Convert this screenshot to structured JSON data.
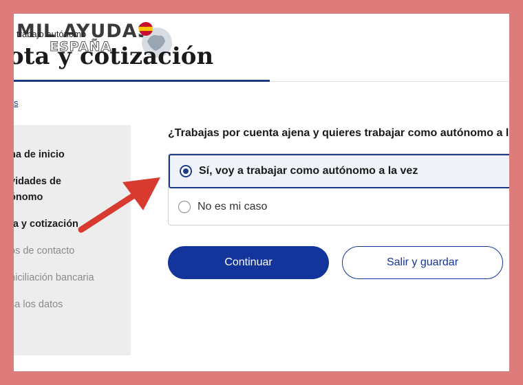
{
  "breadcrumb": "trabajo autónomo",
  "logo": {
    "line1": "MIL AYUDAS",
    "line2": "ESPAÑA"
  },
  "page_title": "ota y cotización",
  "back_link": "s",
  "sidebar": {
    "items": [
      {
        "label": "na de inicio",
        "state": "done"
      },
      {
        "label_line1": "vidades de",
        "label_line2": "ónomo",
        "state": "done"
      },
      {
        "label": "ta y cotización",
        "state": "current"
      },
      {
        "label": "os de contacto",
        "state": "todo"
      },
      {
        "label": "niciliación bancaria",
        "state": "todo"
      },
      {
        "label": "sa los datos",
        "state": "todo"
      }
    ]
  },
  "question": "¿Trabajas por cuenta ajena y quieres trabajar como autónomo a l",
  "options": [
    {
      "label": "Sí, voy a trabajar como autónomo a la vez",
      "selected": true
    },
    {
      "label": "No es mi caso",
      "selected": false
    }
  ],
  "buttons": {
    "continue": "Continuar",
    "save_exit": "Salir y guardar"
  },
  "colors": {
    "accent": "#13349a",
    "frame": "#de7b7b",
    "annotation_arrow": "#d93a2f"
  },
  "icons": {
    "logo_globe": "globe-spain-flag-icon",
    "annotation": "red-arrow-icon"
  }
}
